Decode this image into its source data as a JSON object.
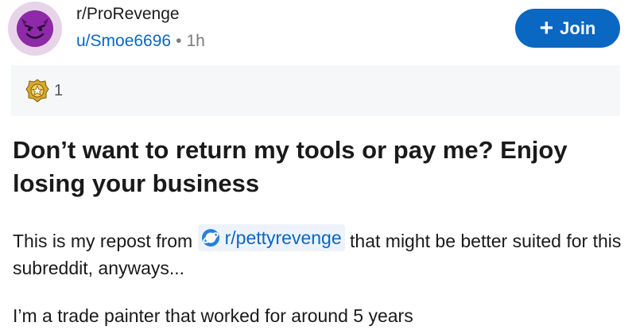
{
  "post": {
    "subreddit": "r/ProRevenge",
    "username": "u/Smoe6696",
    "separator": "•",
    "time_ago": "1h",
    "join_label": "Join",
    "award_count": "1",
    "title": "Don’t want to return my tools or pay me? Enjoy losing your business",
    "body": {
      "para1_prefix": "This is my repost from",
      "linked_subreddit": "r/pettyrevenge",
      "para1_suffix": "that might be better suited for this subreddit, anyways...",
      "para2": "I’m a trade painter that worked for around 5 years"
    }
  },
  "colors": {
    "accent": "#0a67c2",
    "avatar": "#8e2aa8",
    "award_bg": "#f6f7f8"
  },
  "icons": [
    "devil-face-icon",
    "plus-icon",
    "award-icon",
    "subreddit-planet-icon"
  ]
}
